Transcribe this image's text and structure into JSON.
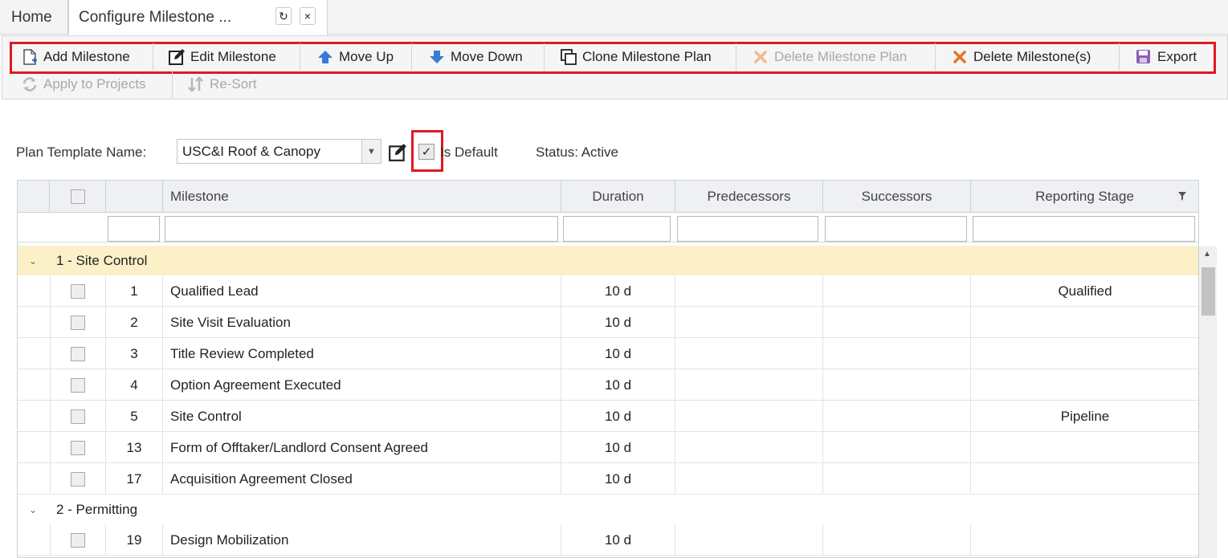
{
  "tabs": {
    "home": "Home",
    "active": "Configure Milestone ...",
    "refresh_glyph": "↻",
    "close_glyph": "×"
  },
  "toolbar": {
    "add_milestone": "Add Milestone",
    "edit_milestone": "Edit Milestone",
    "move_up": "Move Up",
    "move_down": "Move Down",
    "clone_plan": "Clone Milestone Plan",
    "delete_plan": "Delete Milestone Plan",
    "delete_milestones": "Delete Milestone(s)",
    "export": "Export",
    "apply_projects": "Apply to Projects",
    "resort": "Re-Sort"
  },
  "form": {
    "template_label": "Plan Template Name:",
    "template_value": "USC&I Roof & Canopy",
    "is_default_label": "Is Default",
    "is_default_checked": "✓",
    "status": "Status: Active"
  },
  "grid": {
    "columns": {
      "milestone": "Milestone",
      "duration": "Duration",
      "predecessors": "Predecessors",
      "successors": "Successors",
      "reporting_stage": "Reporting Stage"
    },
    "groups": [
      {
        "title": "1 - Site Control",
        "rows": [
          {
            "num": "1",
            "milestone": "Qualified Lead",
            "duration": "10 d",
            "stage": "Qualified"
          },
          {
            "num": "2",
            "milestone": "Site Visit Evaluation",
            "duration": "10 d",
            "stage": ""
          },
          {
            "num": "3",
            "milestone": "Title Review Completed",
            "duration": "10 d",
            "stage": ""
          },
          {
            "num": "4",
            "milestone": "Option Agreement Executed",
            "duration": "10 d",
            "stage": ""
          },
          {
            "num": "5",
            "milestone": "Site Control",
            "duration": "10 d",
            "stage": "Pipeline"
          },
          {
            "num": "13",
            "milestone": "Form of Offtaker/Landlord Consent Agreed",
            "duration": "10 d",
            "stage": ""
          },
          {
            "num": "17",
            "milestone": "Acquisition Agreement Closed",
            "duration": "10 d",
            "stage": ""
          }
        ]
      },
      {
        "title": "2 - Permitting",
        "rows": [
          {
            "num": "19",
            "milestone": "Design Mobilization",
            "duration": "10 d",
            "stage": ""
          }
        ]
      }
    ]
  },
  "colors": {
    "highlight_red": "#e0191f",
    "group_row_bg": "#fbf0c8",
    "header_bg": "#eef0f3"
  }
}
